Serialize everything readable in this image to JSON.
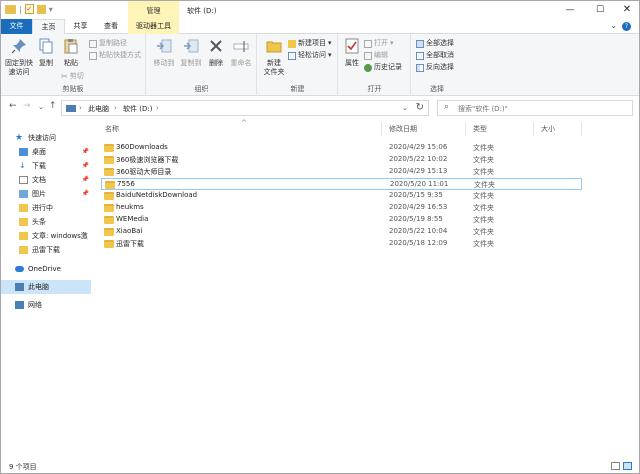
{
  "title_bar": {
    "context_tab_title": "管理",
    "window_title": "软件 (D:)",
    "minimize": "—",
    "maximize": "☐",
    "close": "✕"
  },
  "tabs": [
    {
      "label": "文件"
    },
    {
      "label": "主页"
    },
    {
      "label": "共享"
    },
    {
      "label": "查看"
    },
    {
      "label": "驱动器工具"
    }
  ],
  "ribbon": {
    "clipboard": {
      "label": "剪贴板",
      "pin": "固定到快\n速访问",
      "copy": "复制",
      "paste": "粘贴",
      "copy_path": "复制路径",
      "paste_shortcut": "粘贴快捷方式",
      "cut": "剪切"
    },
    "organize": {
      "label": "组织",
      "move_to": "移动到",
      "copy_to": "复制到",
      "delete": "删除",
      "rename": "重命名"
    },
    "new": {
      "label": "新建",
      "new_folder": "新建\n文件夹",
      "new_item": "新建项目",
      "easy_access": "轻松访问"
    },
    "open": {
      "label": "打开",
      "properties": "属性",
      "open": "打开",
      "edit": "编辑",
      "history": "历史记录"
    },
    "select": {
      "label": "选择",
      "select_all": "全部选择",
      "select_none": "全部取消",
      "invert": "反向选择"
    }
  },
  "address": {
    "crumbs": [
      "此电脑",
      "软件 (D:)"
    ],
    "search_placeholder": "搜索\"软件 (D:)\""
  },
  "nav": {
    "quick_access": "快速访问",
    "items": [
      {
        "label": "桌面",
        "pinned": true
      },
      {
        "label": "下载",
        "pinned": true
      },
      {
        "label": "文档",
        "pinned": true
      },
      {
        "label": "图片",
        "pinned": true
      },
      {
        "label": "进行中",
        "pinned": false
      },
      {
        "label": "头条",
        "pinned": false
      },
      {
        "label": "文章: windows激",
        "pinned": false
      },
      {
        "label": "迅雷下载",
        "pinned": false
      }
    ],
    "onedrive": "OneDrive",
    "this_pc": "此电脑",
    "network": "网络"
  },
  "columns": {
    "name": "名称",
    "modified": "修改日期",
    "type": "类型",
    "size": "大小"
  },
  "files": [
    {
      "name": "360Downloads",
      "modified": "2020/4/29 15:06",
      "type": "文件夹"
    },
    {
      "name": "360极速浏览器下载",
      "modified": "2020/5/22 10:02",
      "type": "文件夹"
    },
    {
      "name": "360驱动大师目录",
      "modified": "2020/4/29 15:13",
      "type": "文件夹"
    },
    {
      "name": "7556",
      "modified": "2020/5/20 11:01",
      "type": "文件夹"
    },
    {
      "name": "BaiduNetdiskDownload",
      "modified": "2020/5/15 9:35",
      "type": "文件夹"
    },
    {
      "name": "heukms",
      "modified": "2020/4/29 16:53",
      "type": "文件夹"
    },
    {
      "name": "WEMedia",
      "modified": "2020/5/19 8:55",
      "type": "文件夹"
    },
    {
      "name": "XiaoBai",
      "modified": "2020/5/22 10:04",
      "type": "文件夹"
    },
    {
      "name": "迅雷下载",
      "modified": "2020/5/18 12:09",
      "type": "文件夹"
    }
  ],
  "status": {
    "item_count": "9 个项目"
  }
}
